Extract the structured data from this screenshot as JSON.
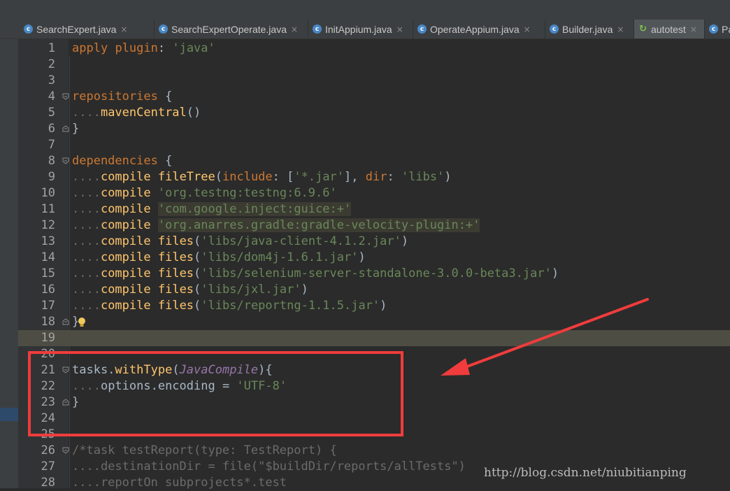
{
  "tabs": [
    {
      "label": "SearchExpert.java",
      "icon": "java-class-icon",
      "active": false
    },
    {
      "label": "SearchExpertOperate.java",
      "icon": "java-class-icon",
      "active": false
    },
    {
      "label": "InitAppium.java",
      "icon": "java-class-icon",
      "active": false
    },
    {
      "label": "OperateAppium.java",
      "icon": "java-class-icon",
      "active": false
    },
    {
      "label": "Builder.java",
      "icon": "java-class-icon",
      "active": false
    },
    {
      "label": "autotest",
      "icon": "gradle-icon",
      "active": true
    },
    {
      "label": "Pag",
      "icon": "java-class-icon",
      "active": false
    }
  ],
  "editor": {
    "caret_line": 19,
    "lines": [
      {
        "n": "1",
        "tokens": [
          [
            "kw",
            "apply"
          ],
          [
            "plain",
            " "
          ],
          [
            "kw",
            "plugin"
          ],
          [
            "plain",
            ": "
          ],
          [
            "str",
            "'java'"
          ]
        ]
      },
      {
        "n": "2",
        "tokens": []
      },
      {
        "n": "3",
        "tokens": []
      },
      {
        "n": "4",
        "fold": "open",
        "tokens": [
          [
            "kw",
            "repositories"
          ],
          [
            "plain",
            " {"
          ]
        ]
      },
      {
        "n": "5",
        "tokens": [
          [
            "dim",
            "...."
          ],
          [
            "fn",
            "mavenCentral"
          ],
          [
            "plain",
            "()"
          ]
        ]
      },
      {
        "n": "6",
        "fold": "close",
        "tokens": [
          [
            "plain",
            "}"
          ]
        ]
      },
      {
        "n": "7",
        "tokens": []
      },
      {
        "n": "8",
        "fold": "open",
        "tokens": [
          [
            "kw",
            "dependencies"
          ],
          [
            "plain",
            " {"
          ]
        ]
      },
      {
        "n": "9",
        "tokens": [
          [
            "dim",
            "...."
          ],
          [
            "fn",
            "compile"
          ],
          [
            "plain",
            " "
          ],
          [
            "fn",
            "fileTree"
          ],
          [
            "plain",
            "("
          ],
          [
            "kw",
            "include"
          ],
          [
            "plain",
            ": ["
          ],
          [
            "str",
            "'*.jar'"
          ],
          [
            "plain",
            "], "
          ],
          [
            "kw",
            "dir"
          ],
          [
            "plain",
            ": "
          ],
          [
            "str",
            "'libs'"
          ],
          [
            "plain",
            ")"
          ]
        ]
      },
      {
        "n": "10",
        "tokens": [
          [
            "dim",
            "...."
          ],
          [
            "fn",
            "compile"
          ],
          [
            "plain",
            " "
          ],
          [
            "str",
            "'org.testng:testng:6.9.6'"
          ]
        ]
      },
      {
        "n": "11",
        "tokens": [
          [
            "dim",
            "...."
          ],
          [
            "fn",
            "compile"
          ],
          [
            "plain",
            " "
          ],
          [
            "strhl",
            "'com.google.inject:guice:+'"
          ]
        ]
      },
      {
        "n": "12",
        "tokens": [
          [
            "dim",
            "...."
          ],
          [
            "fn",
            "compile"
          ],
          [
            "plain",
            " "
          ],
          [
            "strhl",
            "'org.anarres.gradle:gradle-velocity-plugin:+'"
          ]
        ]
      },
      {
        "n": "13",
        "tokens": [
          [
            "dim",
            "...."
          ],
          [
            "fn",
            "compile"
          ],
          [
            "plain",
            " "
          ],
          [
            "fn",
            "files"
          ],
          [
            "plain",
            "("
          ],
          [
            "str",
            "'libs/java-client-4.1.2.jar'"
          ],
          [
            "plain",
            ")"
          ]
        ]
      },
      {
        "n": "14",
        "tokens": [
          [
            "dim",
            "...."
          ],
          [
            "fn",
            "compile"
          ],
          [
            "plain",
            " "
          ],
          [
            "fn",
            "files"
          ],
          [
            "plain",
            "("
          ],
          [
            "str",
            "'libs/dom4j-1.6.1.jar'"
          ],
          [
            "plain",
            ")"
          ]
        ]
      },
      {
        "n": "15",
        "tokens": [
          [
            "dim",
            "...."
          ],
          [
            "fn",
            "compile"
          ],
          [
            "plain",
            " "
          ],
          [
            "fn",
            "files"
          ],
          [
            "plain",
            "("
          ],
          [
            "str",
            "'libs/selenium-server-standalone-3.0.0-beta3.jar'"
          ],
          [
            "plain",
            ")"
          ]
        ]
      },
      {
        "n": "16",
        "tokens": [
          [
            "dim",
            "...."
          ],
          [
            "fn",
            "compile"
          ],
          [
            "plain",
            " "
          ],
          [
            "fn",
            "files"
          ],
          [
            "plain",
            "("
          ],
          [
            "str",
            "'libs/jxl.jar'"
          ],
          [
            "plain",
            ")"
          ]
        ]
      },
      {
        "n": "17",
        "tokens": [
          [
            "dim",
            "...."
          ],
          [
            "fn",
            "compile"
          ],
          [
            "plain",
            " "
          ],
          [
            "fn",
            "files"
          ],
          [
            "plain",
            "("
          ],
          [
            "str",
            "'libs/reportng-1.1.5.jar'"
          ],
          [
            "plain",
            ")"
          ]
        ]
      },
      {
        "n": "18",
        "fold": "close",
        "bulb": true,
        "tokens": [
          [
            "plain",
            "}"
          ]
        ]
      },
      {
        "n": "19",
        "tokens": []
      },
      {
        "n": "20",
        "tokens": []
      },
      {
        "n": "21",
        "fold": "open",
        "tokens": [
          [
            "plain",
            "tasks."
          ],
          [
            "fn",
            "withType"
          ],
          [
            "plain",
            "("
          ],
          [
            "ital",
            "JavaCompile"
          ],
          [
            "plain",
            "){"
          ]
        ]
      },
      {
        "n": "22",
        "tokens": [
          [
            "dim",
            "...."
          ],
          [
            "plain",
            "options.encoding = "
          ],
          [
            "str",
            "'UTF-8'"
          ]
        ]
      },
      {
        "n": "23",
        "fold": "close",
        "tokens": [
          [
            "plain",
            "}"
          ]
        ]
      },
      {
        "n": "24",
        "tokens": []
      },
      {
        "n": "25",
        "tokens": []
      },
      {
        "n": "26",
        "fold": "open",
        "tokens": [
          [
            "dim",
            "/*task testReport(type: TestReport) {"
          ]
        ]
      },
      {
        "n": "27",
        "tokens": [
          [
            "dim",
            "....destinationDir = file(\"$buildDir/reports/allTests\")"
          ]
        ]
      },
      {
        "n": "28",
        "tokens": [
          [
            "dim",
            "....reportOn subprojects*.test"
          ]
        ]
      }
    ]
  },
  "watermark": "http://blog.csdn.net/niubitianping",
  "colors": {
    "keyword": "#cc7832",
    "string": "#6a8759",
    "method": "#ffc66d",
    "type_italic": "#9876aa",
    "annotation_red": "#f03c3c",
    "caret_line_bg": "#4d4d43"
  }
}
